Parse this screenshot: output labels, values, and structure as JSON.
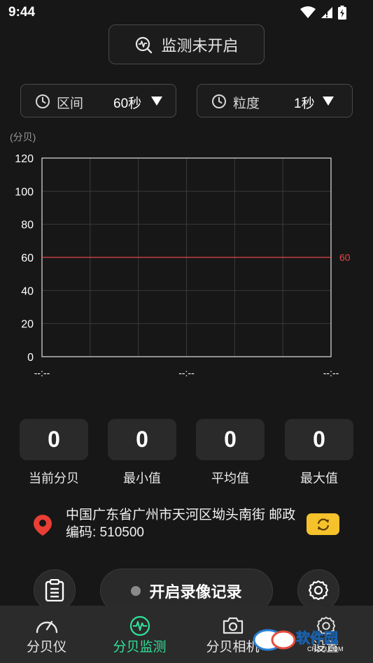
{
  "status_bar": {
    "time": "9:44"
  },
  "monitor_button": {
    "label": "监测未开启"
  },
  "interval_selector": {
    "label": "区间",
    "value": "60秒"
  },
  "granularity_selector": {
    "label": "粒度",
    "value": "1秒"
  },
  "chart_data": {
    "type": "line",
    "ylabel": "(分贝)",
    "ylim": [
      0,
      120
    ],
    "y_ticks": [
      "0",
      "20",
      "40",
      "60",
      "80",
      "100",
      "120"
    ],
    "x_ticks": [
      "--:--",
      "--:--",
      "--:--"
    ],
    "reference_line": {
      "value": 60,
      "label": "60",
      "color": "#e04a4a"
    },
    "series": [],
    "grid": true,
    "colors": {
      "grid": "#3a3a3a",
      "border": "#e0e0e0",
      "axis_text": "#ffffff",
      "ylabel_text": "#9a9a9a"
    }
  },
  "stats": [
    {
      "value": "0",
      "label": "当前分贝"
    },
    {
      "value": "0",
      "label": "最小值"
    },
    {
      "value": "0",
      "label": "平均值"
    },
    {
      "value": "0",
      "label": "最大值"
    }
  ],
  "location": {
    "text": "中国广东省广州市天河区坳头南街 邮政编码: 510500"
  },
  "actions": {
    "record_label": "开启录像记录"
  },
  "bottom_nav": [
    {
      "label": "分贝仪",
      "icon": "speedometer-icon",
      "active": false
    },
    {
      "label": "分贝监测",
      "icon": "activity-icon",
      "active": true
    },
    {
      "label": "分贝相机",
      "icon": "camera-icon",
      "active": false
    },
    {
      "label": "设置",
      "icon": "gear-icon",
      "active": false
    }
  ],
  "watermark": {
    "text": "软件园",
    "subtext": "CR173.COM"
  },
  "colors": {
    "accent": "#2ee39a",
    "refresh": "#f5c22b",
    "location_pin": "#ea3e34",
    "background": "#171717"
  }
}
